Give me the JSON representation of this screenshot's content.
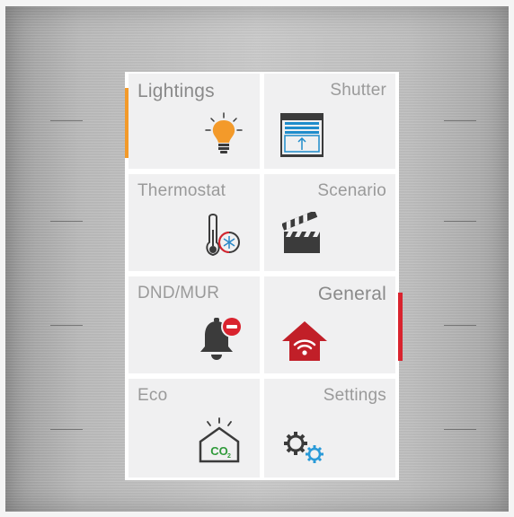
{
  "tiles": [
    {
      "label": "Lightings",
      "icon": "lightbulb-icon",
      "accent": "#f39a2a"
    },
    {
      "label": "Shutter",
      "icon": "shutter-icon"
    },
    {
      "label": "Thermostat",
      "icon": "thermometer-icon"
    },
    {
      "label": "Scenario",
      "icon": "clapperboard-icon"
    },
    {
      "label": "DND/MUR",
      "icon": "bell-dnd-icon"
    },
    {
      "label": "General",
      "icon": "home-wifi-icon",
      "accent": "#d9232e"
    },
    {
      "label": "Eco",
      "icon": "co2-house-icon"
    },
    {
      "label": "Settings",
      "icon": "gears-icon"
    }
  ],
  "colors": {
    "lightings_accent": "#f39a2a",
    "general_accent": "#d9232e",
    "shutter_blue": "#1f8ccb",
    "thermo_blue": "#2a88c8",
    "eco_green": "#2f9a3a",
    "gear_blue": "#2a9ad8",
    "icon_dark": "#3b3b3b"
  }
}
